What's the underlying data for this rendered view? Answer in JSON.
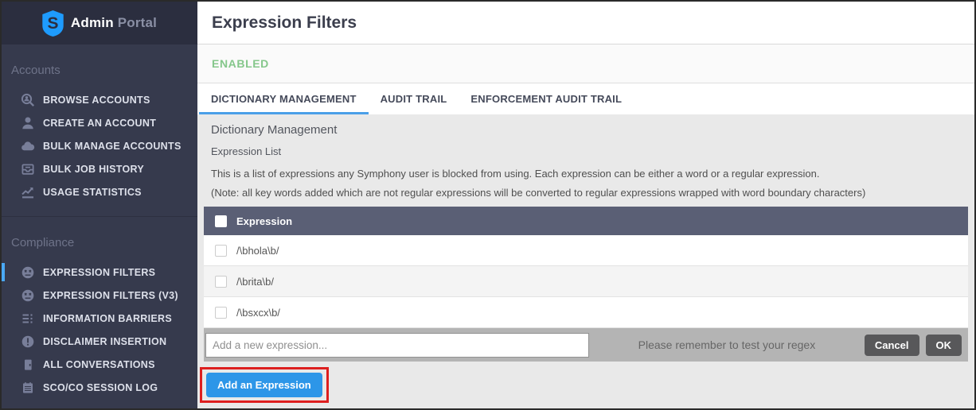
{
  "app": {
    "brand_admin": "Admin",
    "brand_portal": "Portal",
    "logo_icon": "symphony-shield-icon"
  },
  "sidebar": {
    "sections": [
      {
        "label": "Accounts",
        "items": [
          {
            "label": "BROWSE ACCOUNTS",
            "icon": "user-search-icon",
            "active": false
          },
          {
            "label": "CREATE AN ACCOUNT",
            "icon": "user-icon",
            "active": false
          },
          {
            "label": "BULK MANAGE ACCOUNTS",
            "icon": "cloud-icon",
            "active": false
          },
          {
            "label": "BULK JOB HISTORY",
            "icon": "archive-icon",
            "active": false
          },
          {
            "label": "USAGE STATISTICS",
            "icon": "chart-icon",
            "active": false
          }
        ]
      },
      {
        "label": "Compliance",
        "items": [
          {
            "label": "EXPRESSION FILTERS",
            "icon": "muted-face-icon",
            "active": true
          },
          {
            "label": "EXPRESSION FILTERS (V3)",
            "icon": "muted-face-icon",
            "active": false
          },
          {
            "label": "INFORMATION BARRIERS",
            "icon": "barriers-icon",
            "active": false
          },
          {
            "label": "DISCLAIMER INSERTION",
            "icon": "disclaimer-icon",
            "active": false
          },
          {
            "label": "ALL CONVERSATIONS",
            "icon": "conversation-icon",
            "active": false
          },
          {
            "label": "SCO/CO SESSION LOG",
            "icon": "session-log-icon",
            "active": false
          }
        ]
      }
    ]
  },
  "header": {
    "title": "Expression Filters"
  },
  "status": {
    "label": "ENABLED"
  },
  "tabs": [
    {
      "label": "DICTIONARY MANAGEMENT",
      "active": true
    },
    {
      "label": "AUDIT TRAIL",
      "active": false
    },
    {
      "label": "ENFORCEMENT AUDIT TRAIL",
      "active": false
    }
  ],
  "content": {
    "heading": "Dictionary Management",
    "subheading": "Expression List",
    "description": "This is a list of expressions any Symphony user is blocked from using. Each expression can be either a word or a regular expression.",
    "note": "(Note: all key words added which are not regular expressions will be converted to regular expressions wrapped with word boundary characters)",
    "table": {
      "header_label": "Expression",
      "rows": [
        "/\\bhola\\b/",
        "/\\brita\\b/",
        "/\\bsxcx\\b/"
      ]
    },
    "add_bar": {
      "placeholder": "Add a new expression...",
      "hint": "Please remember to test your regex",
      "cancel_label": "Cancel",
      "ok_label": "OK"
    },
    "add_button": {
      "label": "Add an Expression"
    }
  },
  "colors": {
    "sidebar_bg": "#363a4d",
    "sidebar_header_bg": "#2b2e3f",
    "accent_blue": "#2d96e8",
    "active_indicator_blue": "#4aa9f5",
    "tab_underline_blue": "#4a9fe8",
    "status_green": "#85c78b",
    "table_header_bg": "#5a5f75",
    "add_bar_bg": "#b4b4b4",
    "annotation_red": "#dd1f1f",
    "logo_blue": "#1e9bfd"
  }
}
